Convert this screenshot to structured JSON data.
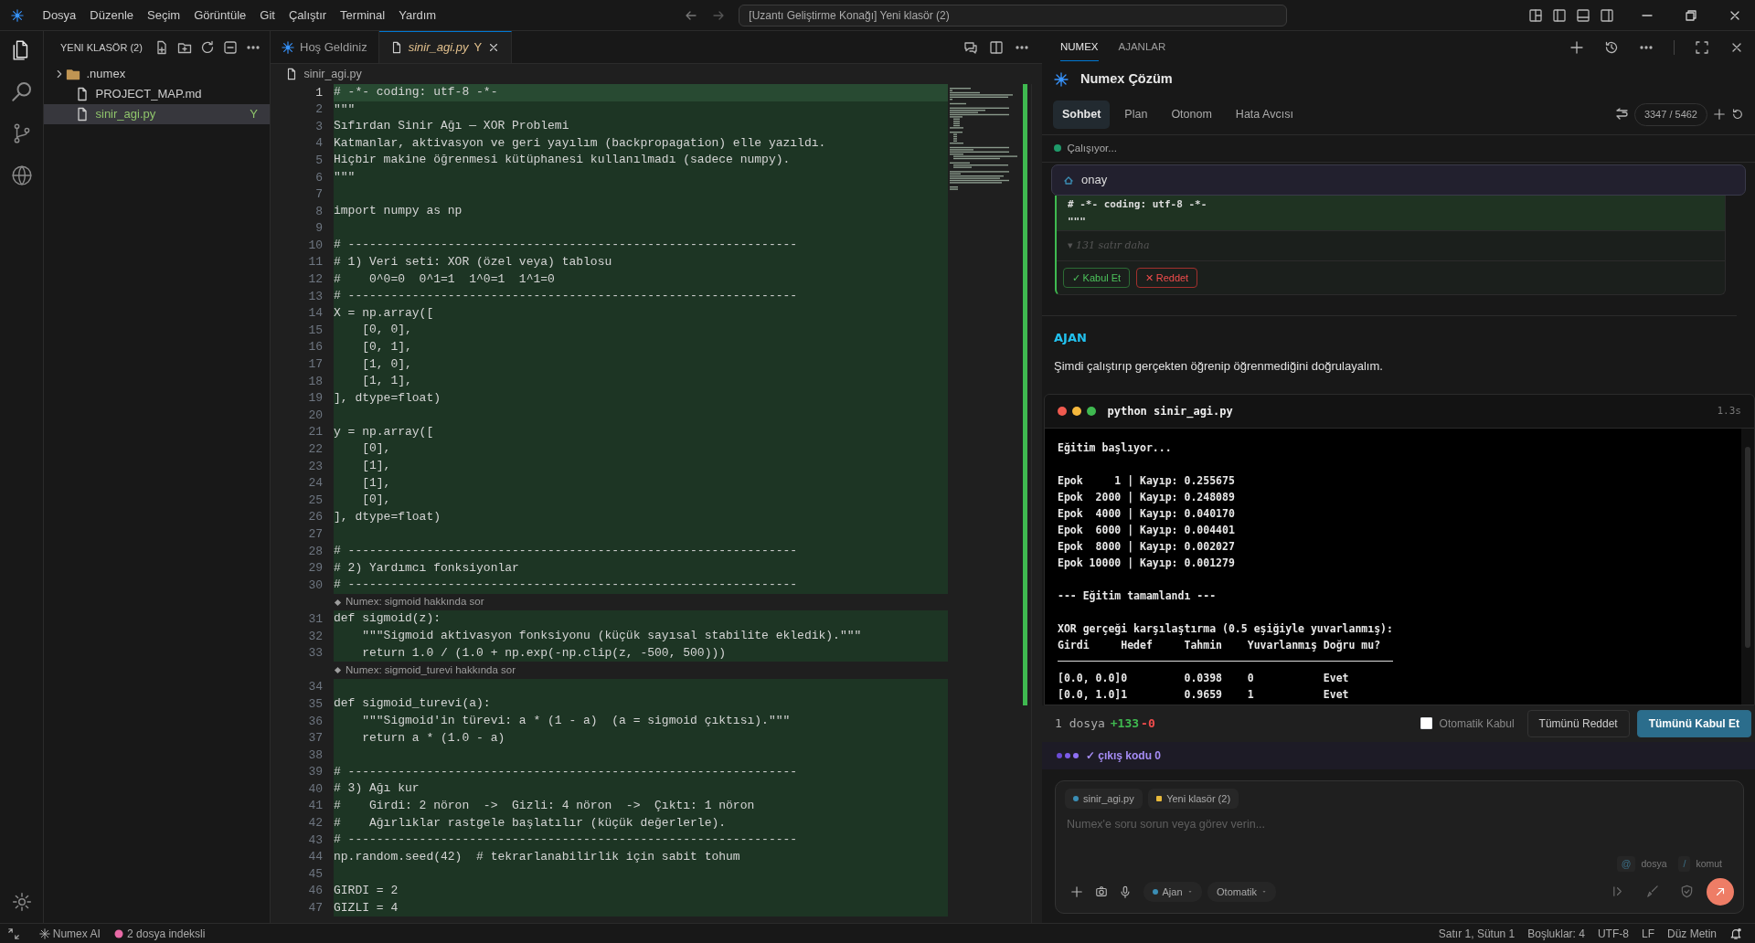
{
  "menubar": {
    "items": [
      "Dosya",
      "Düzenle",
      "Seçim",
      "Görüntüle",
      "Git",
      "Çalıştır",
      "Terminal",
      "Yardım"
    ],
    "command_center": "[Uzantı Geliştirme Konağı] Yeni klasör (2)"
  },
  "explorer": {
    "title": "YENI KLASÖR (2)",
    "items": [
      {
        "kind": "folder",
        "label": ".numex",
        "expanded": false,
        "selected": false
      },
      {
        "kind": "file",
        "label": "PROJECT_MAP.md",
        "selected": false
      },
      {
        "kind": "file",
        "label": "sinir_agi.py",
        "selected": true,
        "badge": "Y"
      }
    ]
  },
  "editor": {
    "tabs": [
      {
        "label": "Hoş Geldiniz",
        "selected": false
      },
      {
        "label": "sinir_agi.py",
        "selected": true,
        "badge": "Y"
      }
    ],
    "breadcrumb": "sinir_agi.py",
    "lines": [
      {
        "kind": "code",
        "number": "1",
        "text": "# -*- coding: utf-8 -*-",
        "current": true
      },
      {
        "kind": "code",
        "number": "2",
        "text": "\"\"\"",
        "current": false
      },
      {
        "kind": "code",
        "number": "3",
        "text": "Sıfırdan Sinir Ağı — XOR Problemi",
        "current": false
      },
      {
        "kind": "code",
        "number": "4",
        "text": "Katmanlar, aktivasyon ve geri yayılım (backpropagation) elle yazıldı.",
        "current": false
      },
      {
        "kind": "code",
        "number": "5",
        "text": "Hiçbir makine öğrenmesi kütüphanesi kullanılmadı (sadece numpy).",
        "current": false
      },
      {
        "kind": "code",
        "number": "6",
        "text": "\"\"\"",
        "current": false
      },
      {
        "kind": "code",
        "number": "7",
        "current": false
      },
      {
        "kind": "code",
        "number": "8",
        "text": "import numpy as np",
        "current": false
      },
      {
        "kind": "code",
        "number": "9",
        "current": false
      },
      {
        "kind": "code",
        "number": "10",
        "text": "# ---------------------------------------------------------------",
        "current": false
      },
      {
        "kind": "code",
        "number": "11",
        "text": "# 1) Veri seti: XOR (özel veya) tablosu",
        "current": false
      },
      {
        "kind": "code",
        "number": "12",
        "text": "#    0^0=0  0^1=1  1^0=1  1^1=0",
        "current": false
      },
      {
        "kind": "code",
        "number": "13",
        "text": "# ---------------------------------------------------------------",
        "current": false
      },
      {
        "kind": "code",
        "number": "14",
        "text": "X = np.array([",
        "current": false
      },
      {
        "kind": "code",
        "number": "15",
        "text": "    [0, 0],",
        "current": false
      },
      {
        "kind": "code",
        "number": "16",
        "text": "    [0, 1],",
        "current": false
      },
      {
        "kind": "code",
        "number": "17",
        "text": "    [1, 0],",
        "current": false
      },
      {
        "kind": "code",
        "number": "18",
        "text": "    [1, 1],",
        "current": false
      },
      {
        "kind": "code",
        "number": "19",
        "text": "], dtype=float)",
        "current": false
      },
      {
        "kind": "code",
        "number": "20",
        "current": false
      },
      {
        "kind": "code",
        "number": "21",
        "text": "y = np.array([",
        "current": false
      },
      {
        "kind": "code",
        "number": "22",
        "text": "    [0],",
        "current": false
      },
      {
        "kind": "code",
        "number": "23",
        "text": "    [1],",
        "current": false
      },
      {
        "kind": "code",
        "number": "24",
        "text": "    [1],",
        "current": false
      },
      {
        "kind": "code",
        "number": "25",
        "text": "    [0],",
        "current": false
      },
      {
        "kind": "code",
        "number": "26",
        "text": "], dtype=float)",
        "current": false
      },
      {
        "kind": "code",
        "number": "27",
        "current": false
      },
      {
        "kind": "code",
        "number": "28",
        "text": "# ---------------------------------------------------------------",
        "current": false
      },
      {
        "kind": "code",
        "number": "29",
        "text": "# 2) Yardımcı fonksiyonlar",
        "current": false
      },
      {
        "kind": "code",
        "number": "30",
        "text": "# ---------------------------------------------------------------",
        "current": false
      },
      {
        "kind": "lens",
        "text": "Numex: sigmoid hakkında sor"
      },
      {
        "kind": "code",
        "number": "31",
        "text": "def sigmoid(z):",
        "current": false
      },
      {
        "kind": "code",
        "number": "32",
        "text": "    \"\"\"Sigmoid aktivasyon fonksiyonu (küçük sayısal stabilite ekledik).\"\"\"",
        "current": false
      },
      {
        "kind": "code",
        "number": "33",
        "text": "    return 1.0 / (1.0 + np.exp(-np.clip(z, -500, 500)))",
        "current": false
      },
      {
        "kind": "lens",
        "text": "Numex: sigmoid_turevi hakkında sor"
      },
      {
        "kind": "code",
        "number": "34",
        "current": false
      },
      {
        "kind": "code",
        "number": "35",
        "text": "def sigmoid_turevi(a):",
        "current": false
      },
      {
        "kind": "code",
        "number": "36",
        "text": "    \"\"\"Sigmoid'in türevi: a * (1 - a)  (a = sigmoid çıktısı).\"\"\"",
        "current": false
      },
      {
        "kind": "code",
        "number": "37",
        "text": "    return a * (1.0 - a)",
        "current": false
      },
      {
        "kind": "code",
        "number": "38",
        "current": false
      },
      {
        "kind": "code",
        "number": "39",
        "text": "# ---------------------------------------------------------------",
        "current": false
      },
      {
        "kind": "code",
        "number": "40",
        "text": "# 3) Ağı kur",
        "current": false
      },
      {
        "kind": "code",
        "number": "41",
        "text": "#    Girdi: 2 nöron  ->  Gizli: 4 nöron  ->  Çıktı: 1 nöron",
        "current": false
      },
      {
        "kind": "code",
        "number": "42",
        "text": "#    Ağırlıklar rastgele başlatılır (küçük değerlerle).",
        "current": false
      },
      {
        "kind": "code",
        "number": "43",
        "text": "# ---------------------------------------------------------------",
        "current": false
      },
      {
        "kind": "code",
        "number": "44",
        "text": "np.random.seed(42)  # tekrarlanabilirlik için sabit tohum",
        "current": false
      },
      {
        "kind": "code",
        "number": "45",
        "current": false
      },
      {
        "kind": "code",
        "number": "46",
        "text": "GIRDI = 2",
        "current": false
      },
      {
        "kind": "code",
        "number": "47",
        "text": "GIZLI = 4",
        "current": false
      }
    ]
  },
  "assistant": {
    "tabs": [
      {
        "label": "NUMEX",
        "selected": true
      },
      {
        "label": "AJANLAR",
        "selected": false
      }
    ],
    "title": "Numex Çözüm",
    "modes": [
      {
        "label": "Sohbet",
        "selected": true
      },
      {
        "label": "Plan",
        "selected": false
      },
      {
        "label": "Otonom",
        "selected": false
      },
      {
        "label": "Hata Avcısı",
        "selected": false
      }
    ],
    "token_counter": "3347 / 5462",
    "status": "Çalışıyor...",
    "prompt": "onay",
    "diff": {
      "lines": [
        "# -*- coding: utf-8 -*-",
        "\"\"\""
      ],
      "more": "▾ 131 satır daha",
      "accept": "✓ Kabul Et",
      "reject": "✕ Reddet"
    },
    "agent": {
      "label": "AJAN",
      "message": "Şimdi çalıştırıp gerçekten öğrenip öğrenmediğini doğrulayalım."
    },
    "terminal": {
      "command": "python sinir_agi.py",
      "duration": "1.3s",
      "output": [
        {
          "kind": "text",
          "text": "Eğitim başlıyor..."
        },
        {
          "kind": "blank"
        },
        {
          "kind": "text",
          "text": "Epok     1 | Kayıp: 0.255675"
        },
        {
          "kind": "text",
          "text": "Epok  2000 | Kayıp: 0.248089"
        },
        {
          "kind": "text",
          "text": "Epok  4000 | Kayıp: 0.040170"
        },
        {
          "kind": "text",
          "text": "Epok  6000 | Kayıp: 0.004401"
        },
        {
          "kind": "text",
          "text": "Epok  8000 | Kayıp: 0.002027"
        },
        {
          "kind": "text",
          "text": "Epok 10000 | Kayıp: 0.001279"
        },
        {
          "kind": "blank"
        },
        {
          "kind": "text",
          "text": "--- Eğitim tamamlandı ---"
        },
        {
          "kind": "blank"
        },
        {
          "kind": "text",
          "text": "XOR gerçeği karşılaştırma (0.5 eşiğiyle yuvarlanmış):"
        },
        {
          "kind": "text",
          "text": "Girdi     Hedef     Tahmin    Yuvarlanmış Doğru mu?"
        },
        {
          "kind": "rule"
        },
        {
          "kind": "text",
          "text": "[0.0, 0.0]0         0.0398    0           Evet"
        },
        {
          "kind": "text",
          "text": "[0.0, 1.0]1         0.9659    1           Evet"
        }
      ]
    },
    "summary": {
      "files": "1 dosya",
      "added": "+133",
      "removed": "-0",
      "auto_accept": {
        "label": "Otomatik Kabul",
        "checked": false
      },
      "reject_all": "Tümünü Reddet",
      "accept_all": "Tümünü Kabul Et"
    },
    "exit_status": "✓ çıkış kodu 0",
    "composer": {
      "chips": [
        {
          "label": "sinir_agi.py",
          "color": "#3b8eb5"
        },
        {
          "label": "Yeni klasör (2)",
          "color": "#e8b93a"
        }
      ],
      "placeholder": "Numex'e soru sorun veya görev verin...",
      "hints": [
        {
          "key": "@",
          "label": "dosya"
        },
        {
          "key": "/",
          "label": "komut"
        }
      ],
      "agent_mode": "Ajan",
      "approval": "Otomatik"
    }
  },
  "status_bar": {
    "left": [
      "Numex AI",
      "2 dosya indeksli"
    ],
    "right": [
      "Satır 1, Sütun 1",
      "Boşluklar: 4",
      "UTF-8",
      "LF",
      "Düz Metin"
    ]
  }
}
